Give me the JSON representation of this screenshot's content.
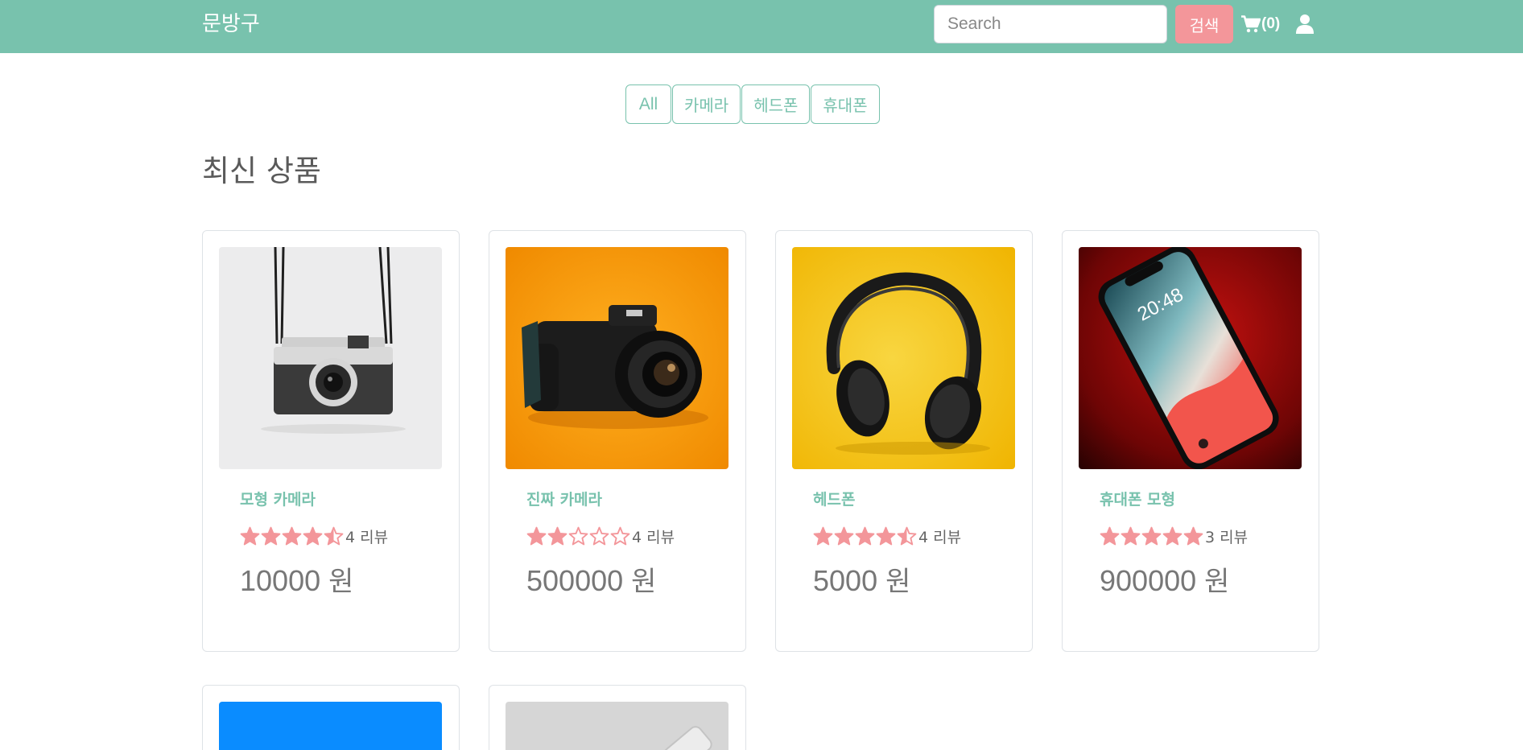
{
  "navbar": {
    "brand": "문방구",
    "search_placeholder": "Search",
    "search_button": "검색",
    "cart_count": "(0)",
    "cart_icon": "cart-icon",
    "user_icon": "user-icon"
  },
  "filters": [
    "All",
    "카메라",
    "헤드폰",
    "휴대폰"
  ],
  "section_title": "최신 상품",
  "currency_label": "원",
  "colors": {
    "primary": "#78c2ad",
    "secondary": "#f3969a",
    "star": "#f3969a"
  },
  "products": [
    {
      "name": "모형 카메라",
      "rating": 4.5,
      "reviews": "4 리뷰",
      "price": "10000",
      "image": "vintage-camera-photo"
    },
    {
      "name": "진짜 카메라",
      "rating": 2,
      "reviews": "4 리뷰",
      "price": "500000",
      "image": "dslr-camera-photo"
    },
    {
      "name": "헤드폰",
      "rating": 4.5,
      "reviews": "4 리뷰",
      "price": "5000",
      "image": "headphones-photo"
    },
    {
      "name": "휴대폰 모형",
      "rating": 5,
      "reviews": "3 리뷰",
      "price": "900000",
      "image": "smartphone-photo",
      "image_text": "20:48"
    }
  ],
  "partial_products": [
    {
      "image": "blue-product-photo"
    },
    {
      "image": "grey-product-photo"
    }
  ]
}
